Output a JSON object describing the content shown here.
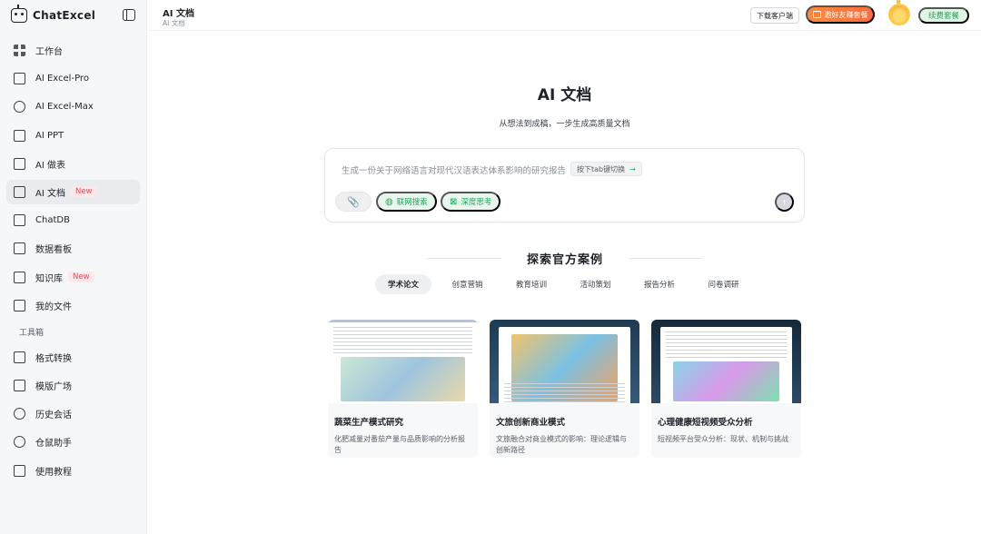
{
  "brand": {
    "name": "ChatExcel"
  },
  "sidebar": {
    "items": [
      {
        "label": "工作台",
        "icon": "dashboard-grid-icon"
      },
      {
        "label": "AI Excel-Pro",
        "icon": "sheet-icon"
      },
      {
        "label": "AI Excel-Max",
        "icon": "spark-icon"
      },
      {
        "label": "AI PPT",
        "icon": "slides-icon"
      },
      {
        "label": "AI 做表",
        "icon": "table-icon"
      },
      {
        "label": "AI 文档",
        "icon": "document-icon",
        "badge": "New",
        "active": true
      },
      {
        "label": "ChatDB",
        "icon": "database-icon"
      },
      {
        "label": "数据看板",
        "icon": "chart-icon"
      },
      {
        "label": "知识库",
        "icon": "book-icon",
        "badge": "New"
      },
      {
        "label": "我的文件",
        "icon": "folder-icon"
      }
    ],
    "toolbox_label": "工具箱",
    "tools": [
      {
        "label": "格式转换",
        "icon": "convert-icon"
      },
      {
        "label": "模版广场",
        "icon": "template-icon"
      },
      {
        "label": "历史会话",
        "icon": "history-icon"
      },
      {
        "label": "仓鼠助手",
        "icon": "hamster-icon"
      },
      {
        "label": "使用教程",
        "icon": "tutorial-icon"
      }
    ]
  },
  "header": {
    "title": "AI 文档",
    "breadcrumb": "AI 文档",
    "download_label": "下载客户端",
    "invite_label": "邀好友赚套餐",
    "renew_label": "续费套餐"
  },
  "main": {
    "title": "AI 文档",
    "subtitle": "从想法到成稿，一步生成高质量文档",
    "prompt_placeholder": "生成一份关于网络语言对现代汉语表达体系影响的研究报告",
    "tab_hint": "按下tab键切换",
    "tab_hint_arrow": "→",
    "chip_web": "联网搜索",
    "chip_deep": "深度思考",
    "section_title": "探索官方案例",
    "tabs": [
      "学术论文",
      "创意营销",
      "教育培训",
      "活动策划",
      "报告分析",
      "问卷调研"
    ],
    "cards": [
      {
        "title": "蔬菜生产模式研究",
        "desc": "化肥减量对番茄产量与品质影响的分析报告"
      },
      {
        "title": "文旅创新商业模式",
        "desc": "文旅融合对商业模式的影响：理论逻辑与创新路径"
      },
      {
        "title": "心理健康短视频受众分析",
        "desc": "短视频平台受众分析：现状、机制与挑战"
      }
    ]
  },
  "colors": {
    "accent_green": "#22a55a",
    "invite_orange": "#ff7a3d",
    "badge_red": "#e34d59"
  }
}
